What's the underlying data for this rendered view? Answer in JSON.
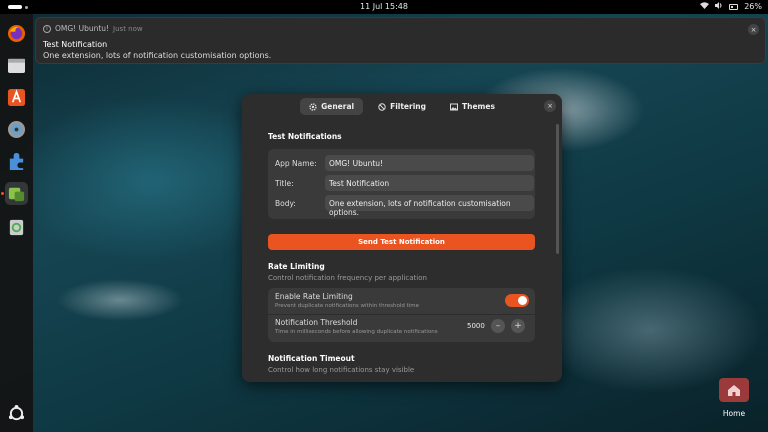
{
  "topbar": {
    "clock": "11 Jul 15:48",
    "battery": "26%"
  },
  "dock": {
    "apps": [
      "firefox-icon",
      "files-icon",
      "app-center-icon",
      "disc-icon",
      "extensions-icon",
      "extension-manager-icon",
      "trash-icon"
    ],
    "apps_grid": "show-apps-icon"
  },
  "notification": {
    "app_name": "OMG! Ubuntu!",
    "time": "Just now",
    "title": "Test Notification",
    "body": "One extension, lots of notification customisation options.",
    "close": "×"
  },
  "dialog": {
    "tabs": [
      {
        "label": "General",
        "icon": "gear-icon"
      },
      {
        "label": "Filtering",
        "icon": "block-icon"
      },
      {
        "label": "Themes",
        "icon": "image-icon"
      }
    ],
    "close": "×",
    "test": {
      "heading": "Test Notifications",
      "app_name_label": "App Name:",
      "app_name_value": "OMG! Ubuntu!",
      "title_label": "Title:",
      "title_value": "Test Notification",
      "body_label": "Body:",
      "body_value": "One extension, lots of notification customisation options.",
      "send_button": "Send Test Notification"
    },
    "rate": {
      "heading": "Rate Limiting",
      "subtitle": "Control notification frequency per application",
      "enable_label": "Enable Rate Limiting",
      "enable_desc": "Prevent duplicate notifications within threshold time",
      "enabled": true,
      "threshold_label": "Notification Threshold",
      "threshold_desc": "Time in milliseconds before allowing duplicate notifications",
      "threshold_value": "5000",
      "minus": "–",
      "plus": "+"
    },
    "timeout": {
      "heading": "Notification Timeout",
      "subtitle": "Control how long notifications stay visible"
    }
  },
  "desktop": {
    "home_label": "Home"
  },
  "colors": {
    "accent": "#e95420",
    "dialog_bg": "#2d2d2d",
    "group_bg": "#3a3a3a"
  }
}
